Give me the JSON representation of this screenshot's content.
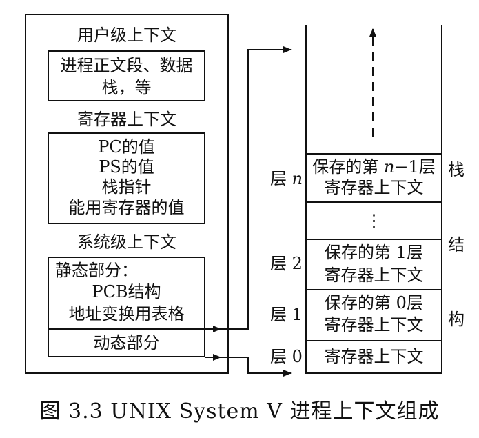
{
  "left_panel": {
    "user_context": {
      "title": "用户级上下文",
      "lines": [
        "进程正文段、数据",
        "栈，等"
      ]
    },
    "register_context": {
      "title": "寄存器上下文",
      "lines": [
        "PC的值",
        "PS的值",
        "栈指针",
        "能用寄存器的值"
      ]
    },
    "system_context": {
      "title": "系统级上下文",
      "static_title": "静态部分：",
      "static_lines": [
        "PCB结构",
        "地址变换用表格"
      ],
      "dynamic_label": "动态部分"
    }
  },
  "stack": {
    "side_label_chars": [
      "栈",
      "结",
      "构"
    ],
    "ellipsis": "⋮",
    "layers": [
      {
        "label_prefix": "层",
        "label_var": "n",
        "lines_pre": [
          "保存的第 "
        ],
        "var": "n",
        "lines_post": "−1层",
        "line2": "寄存器上下文"
      },
      {
        "label": "层 2",
        "line1": "保存的第 1层",
        "line2": "寄存器上下文"
      },
      {
        "label": "层 1",
        "line1": "保存的第 0层",
        "line2": "寄存器上下文"
      },
      {
        "label": "层 0",
        "line1": "寄存器上下文"
      }
    ]
  },
  "caption": "图 3.3 UNIX System V 进程上下文组成"
}
